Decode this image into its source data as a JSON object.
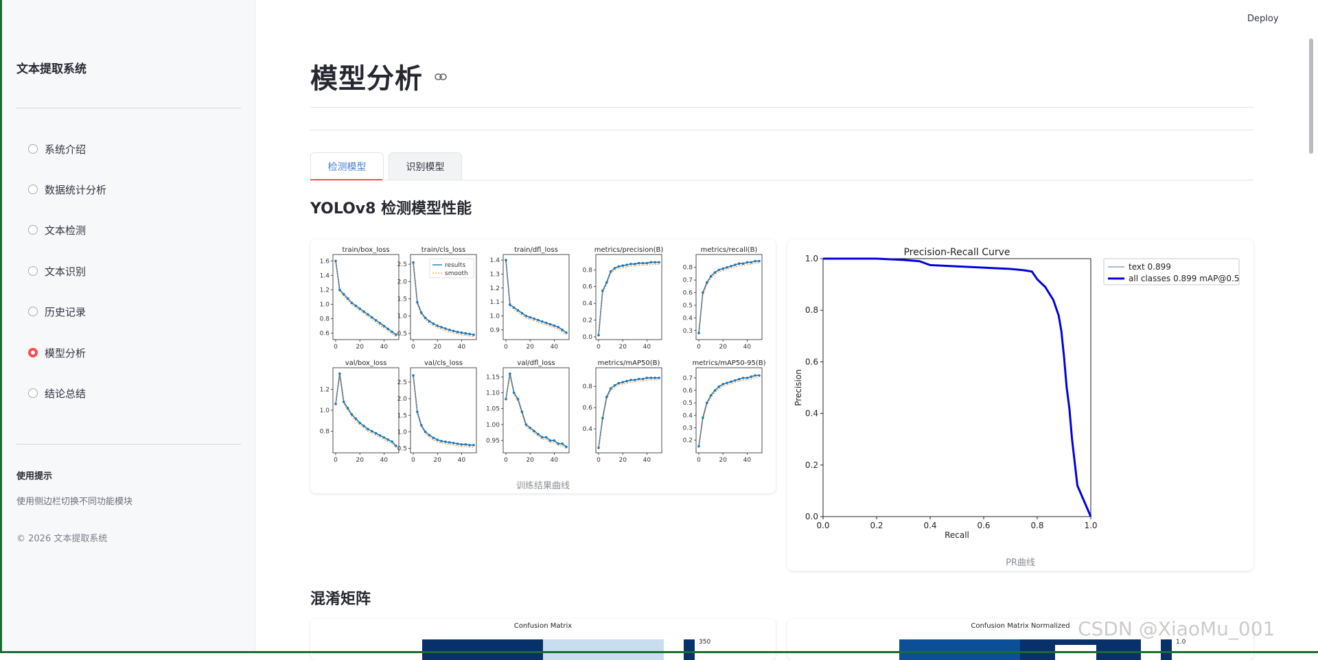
{
  "sidebar": {
    "title": "文本提取系统",
    "nav": [
      {
        "label": "系统介绍",
        "selected": false
      },
      {
        "label": "数据统计分析",
        "selected": false
      },
      {
        "label": "文本检测",
        "selected": false
      },
      {
        "label": "文本识别",
        "selected": false
      },
      {
        "label": "历史记录",
        "selected": false
      },
      {
        "label": "模型分析",
        "selected": true
      },
      {
        "label": "结论总结",
        "selected": false
      }
    ],
    "tip_title": "使用提示",
    "tip_text": "使用侧边栏切换不同功能模块",
    "copyright": "© 2026 文本提取系统"
  },
  "header": {
    "deploy": "Deploy"
  },
  "main": {
    "title": "模型分析",
    "tabs": [
      {
        "label": "检测模型",
        "active": true
      },
      {
        "label": "识别模型",
        "active": false
      }
    ],
    "section1": "YOLOv8 检测模型性能",
    "train_caption": "训练结果曲线",
    "pr_caption": "PR曲线",
    "section2": "混淆矩阵",
    "cm_title1": "Confusion Matrix",
    "cm_title2": "Confusion Matrix Normalized",
    "cm_tick1": "350",
    "cm_tick2": "1.0"
  },
  "training_panels": [
    {
      "title": "train/box_loss",
      "xticks": [
        "0",
        "20",
        "40"
      ],
      "yticks": [
        "0.6",
        "0.8",
        "1.0",
        "1.2",
        "1.4",
        "1.6"
      ],
      "ylim": [
        0.55,
        1.65
      ],
      "values": [
        1.6,
        1.2,
        1.14,
        1.08,
        1.02,
        0.98,
        0.94,
        0.9,
        0.86,
        0.82,
        0.78,
        0.74,
        0.7,
        0.66,
        0.62,
        0.58
      ]
    },
    {
      "title": "train/cls_loss",
      "xticks": [
        "0",
        "20",
        "40"
      ],
      "yticks": [
        "0.5",
        "1.0",
        "1.5",
        "2.0",
        "2.5"
      ],
      "ylim": [
        0.4,
        2.7
      ],
      "values": [
        2.55,
        1.4,
        1.1,
        0.95,
        0.85,
        0.78,
        0.72,
        0.68,
        0.64,
        0.6,
        0.57,
        0.54,
        0.52,
        0.5,
        0.48,
        0.46
      ],
      "legend": [
        "results",
        "smooth"
      ]
    },
    {
      "title": "train/dfl_loss",
      "xticks": [
        "0",
        "20",
        "40"
      ],
      "yticks": [
        "0.9",
        "1.0",
        "1.1",
        "1.2",
        "1.3",
        "1.4"
      ],
      "ylim": [
        0.85,
        1.42
      ],
      "values": [
        1.4,
        1.08,
        1.06,
        1.04,
        1.02,
        1.0,
        0.99,
        0.98,
        0.97,
        0.96,
        0.95,
        0.94,
        0.93,
        0.92,
        0.9,
        0.88
      ]
    },
    {
      "title": "metrics/precision(B)",
      "xticks": [
        "0",
        "20",
        "40"
      ],
      "yticks": [
        "0.0",
        "0.2",
        "0.4",
        "0.6",
        "0.8"
      ],
      "ylim": [
        0,
        0.95
      ],
      "values": [
        0.02,
        0.55,
        0.65,
        0.78,
        0.82,
        0.84,
        0.85,
        0.86,
        0.87,
        0.87,
        0.88,
        0.88,
        0.88,
        0.89,
        0.89,
        0.89
      ]
    },
    {
      "title": "metrics/recall(B)",
      "xticks": [
        "0",
        "20",
        "40"
      ],
      "yticks": [
        "0.3",
        "0.4",
        "0.5",
        "0.6",
        "0.7",
        "0.8"
      ],
      "ylim": [
        0.25,
        0.88
      ],
      "values": [
        0.28,
        0.6,
        0.68,
        0.73,
        0.76,
        0.78,
        0.79,
        0.8,
        0.81,
        0.82,
        0.83,
        0.83,
        0.84,
        0.84,
        0.85,
        0.85
      ]
    },
    {
      "title": "val/box_loss",
      "xticks": [
        "0",
        "20",
        "40"
      ],
      "yticks": [
        "0.8",
        "1.0",
        "1.2"
      ],
      "ylim": [
        0.62,
        1.38
      ],
      "values": [
        1.06,
        1.35,
        1.08,
        1.02,
        0.96,
        0.92,
        0.88,
        0.85,
        0.82,
        0.8,
        0.78,
        0.76,
        0.74,
        0.72,
        0.7,
        0.66
      ]
    },
    {
      "title": "val/cls_loss",
      "xticks": [
        "0",
        "20",
        "40"
      ],
      "yticks": [
        "0.5",
        "1.0",
        "1.5",
        "2.0",
        "2.5"
      ],
      "ylim": [
        0.45,
        2.85
      ],
      "values": [
        2.7,
        1.6,
        1.2,
        1.0,
        0.9,
        0.82,
        0.76,
        0.72,
        0.7,
        0.68,
        0.66,
        0.64,
        0.62,
        0.62,
        0.6,
        0.6
      ]
    },
    {
      "title": "val/dfl_loss",
      "xticks": [
        "0",
        "20",
        "40"
      ],
      "yticks": [
        "0.95",
        "1.00",
        "1.05",
        "1.10",
        "1.15"
      ],
      "ylim": [
        0.92,
        1.17
      ],
      "values": [
        1.08,
        1.16,
        1.1,
        1.08,
        1.04,
        1.0,
        0.99,
        0.98,
        0.97,
        0.96,
        0.96,
        0.95,
        0.95,
        0.94,
        0.94,
        0.93
      ]
    },
    {
      "title": "metrics/mAP50(B)",
      "xticks": [
        "0",
        "20",
        "40"
      ],
      "yticks": [
        "0.4",
        "0.6",
        "0.8"
      ],
      "ylim": [
        0.2,
        0.95
      ],
      "values": [
        0.22,
        0.5,
        0.7,
        0.78,
        0.81,
        0.83,
        0.84,
        0.85,
        0.86,
        0.86,
        0.87,
        0.87,
        0.88,
        0.88,
        0.88,
        0.88
      ]
    },
    {
      "title": "metrics/mAP50-95(B)",
      "xticks": [
        "0",
        "20",
        "40"
      ],
      "yticks": [
        "0.2",
        "0.3",
        "0.4",
        "0.5",
        "0.6",
        "0.7"
      ],
      "ylim": [
        0.12,
        0.76
      ],
      "values": [
        0.15,
        0.38,
        0.5,
        0.56,
        0.6,
        0.63,
        0.65,
        0.66,
        0.67,
        0.68,
        0.69,
        0.7,
        0.7,
        0.71,
        0.72,
        0.72
      ]
    }
  ],
  "chart_data": {
    "type": "line",
    "title": "Precision-Recall Curve",
    "xlabel": "Recall",
    "ylabel": "Precision",
    "xlim": [
      0,
      1
    ],
    "ylim": [
      0,
      1
    ],
    "xticks": [
      "0.0",
      "0.2",
      "0.4",
      "0.6",
      "0.8",
      "1.0"
    ],
    "yticks": [
      "0.0",
      "0.2",
      "0.4",
      "0.6",
      "0.8",
      "1.0"
    ],
    "legend_position": "top-right, outside",
    "series": [
      {
        "name": "text 0.899",
        "color": "#6f8fd8",
        "x": [
          0,
          0.2,
          0.3,
          0.36,
          0.4,
          0.5,
          0.6,
          0.7,
          0.75,
          0.78,
          0.8,
          0.83,
          0.86,
          0.88,
          0.89,
          0.9,
          0.91,
          0.92,
          0.93,
          0.95,
          1.0
        ],
        "y": [
          1,
          1,
          0.995,
          0.99,
          0.975,
          0.97,
          0.965,
          0.96,
          0.955,
          0.95,
          0.92,
          0.89,
          0.84,
          0.78,
          0.72,
          0.62,
          0.5,
          0.42,
          0.3,
          0.12,
          0.0
        ]
      },
      {
        "name": "all classes 0.899 mAP@0.5",
        "color": "#0000dd",
        "x": [
          0,
          0.2,
          0.3,
          0.36,
          0.4,
          0.5,
          0.6,
          0.7,
          0.75,
          0.78,
          0.8,
          0.83,
          0.86,
          0.88,
          0.89,
          0.9,
          0.91,
          0.92,
          0.93,
          0.95,
          1.0
        ],
        "y": [
          1,
          1,
          0.995,
          0.99,
          0.975,
          0.97,
          0.965,
          0.96,
          0.955,
          0.95,
          0.92,
          0.89,
          0.84,
          0.78,
          0.72,
          0.62,
          0.5,
          0.42,
          0.3,
          0.12,
          0.0
        ]
      }
    ]
  },
  "watermark": "CSDN @XiaoMu_001",
  "colors": {
    "accent": "#ff4b4b",
    "tab_active": "#4a7fd4",
    "frame": "#1d6b32"
  }
}
